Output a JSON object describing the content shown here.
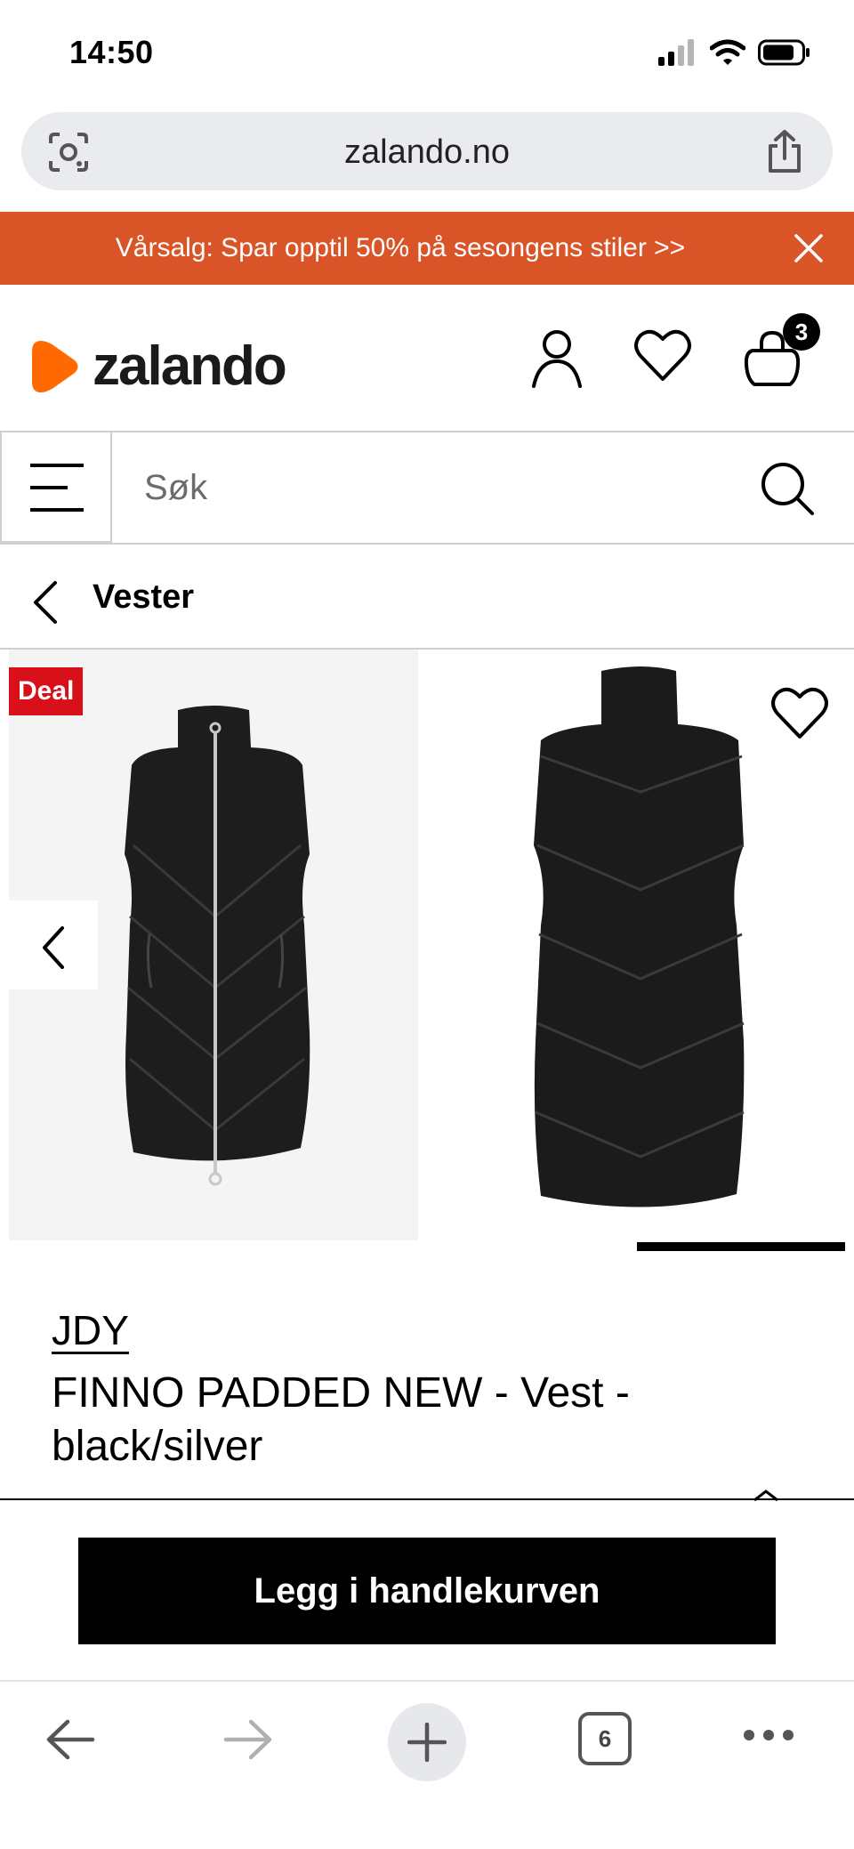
{
  "status_bar": {
    "time": "14:50"
  },
  "browser": {
    "url": "zalando.no",
    "tab_count": "6"
  },
  "promo": {
    "text": "Vårsalg: Spar opptil 50% på sesongens stiler >>"
  },
  "header": {
    "logo_text": "zalando",
    "cart_count": "3",
    "brand_color": "#ff6900"
  },
  "search": {
    "placeholder": "Søk"
  },
  "breadcrumb": {
    "label": "Vester"
  },
  "gallery": {
    "badge": "Deal",
    "badge_color": "#d8101a"
  },
  "product": {
    "brand": "JDY",
    "name": "FINNO PADDED NEW - Vest - black/silver"
  },
  "cta": {
    "label": "Legg i handlekurven"
  },
  "icons": [
    "lens-icon",
    "share-icon",
    "close-icon",
    "account-icon",
    "heart-icon",
    "bag-icon",
    "menu-icon",
    "search-icon",
    "back-icon",
    "chevron-up-icon",
    "arrow-left-icon",
    "arrow-right-icon",
    "plus-icon",
    "more-icon"
  ]
}
